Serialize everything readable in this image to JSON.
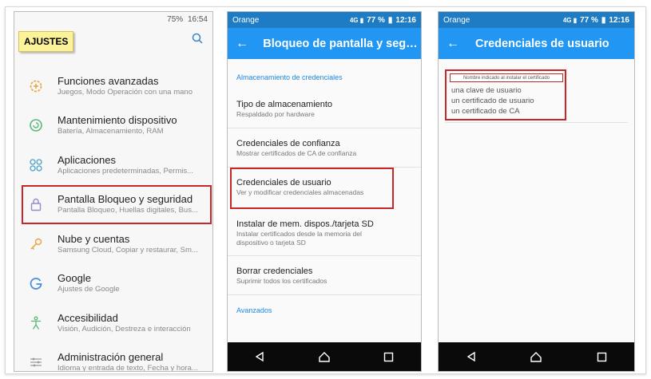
{
  "panel1": {
    "status": {
      "text": "75%",
      "time": "16:54"
    },
    "title": "AJUSTES",
    "items": [
      {
        "title": "Funciones avanzadas",
        "sub": "Juegos, Modo Operación con una mano",
        "icon": "gear-plus-icon"
      },
      {
        "title": "Mantenimiento dispositivo",
        "sub": "Batería, Almacenamiento, RAM",
        "icon": "refresh-circle-icon"
      },
      {
        "title": "Aplicaciones",
        "sub": "Aplicaciones predeterminadas, Permis...",
        "icon": "apps-grid-icon"
      },
      {
        "title": "Pantalla Bloqueo y seguridad",
        "sub": "Pantalla Bloqueo, Huellas digitales, Bus...",
        "icon": "lock-icon"
      },
      {
        "title": "Nube y cuentas",
        "sub": "Samsung Cloud, Copiar y restaurar, Sm...",
        "icon": "key-icon"
      },
      {
        "title": "Google",
        "sub": "Ajustes de Google",
        "icon": "google-icon"
      },
      {
        "title": "Accesibilidad",
        "sub": "Visión, Audición, Destreza e interacción",
        "icon": "accessibility-icon"
      },
      {
        "title": "Administración general",
        "sub": "Idioma y entrada de texto, Fecha y hora...",
        "icon": "sliders-icon"
      }
    ]
  },
  "panel2": {
    "status": {
      "carrier": "Orange",
      "battery": "77 %",
      "time": "12:16"
    },
    "title": "Bloqueo de pantalla y segurid...",
    "section": "Almacenamiento de credenciales",
    "prefs": [
      {
        "title": "Tipo de almacenamiento",
        "sub": "Respaldado por hardware"
      },
      {
        "title": "Credenciales de confianza",
        "sub": "Mostrar certificados de CA de confianza"
      },
      {
        "title": "Credenciales de usuario",
        "sub": "Ver y modificar credenciales almacenadas"
      },
      {
        "title": "Instalar de mem. dispos./tarjeta SD",
        "sub1": "Instalar certificados desde la memoria del",
        "sub2": "dispositivo o tarjeta SD"
      },
      {
        "title": "Borrar credenciales",
        "sub": "Suprimir todos los certificados"
      }
    ],
    "advanced": "Avanzados"
  },
  "panel3": {
    "status": {
      "carrier": "Orange",
      "battery": "77 %",
      "time": "12:16"
    },
    "title": "Credenciales de usuario",
    "tag": "Nombre indicado al instalar el certificado",
    "lines": [
      "una clave de usuario",
      "un certificado de usuario",
      "un certificado de CA"
    ]
  }
}
